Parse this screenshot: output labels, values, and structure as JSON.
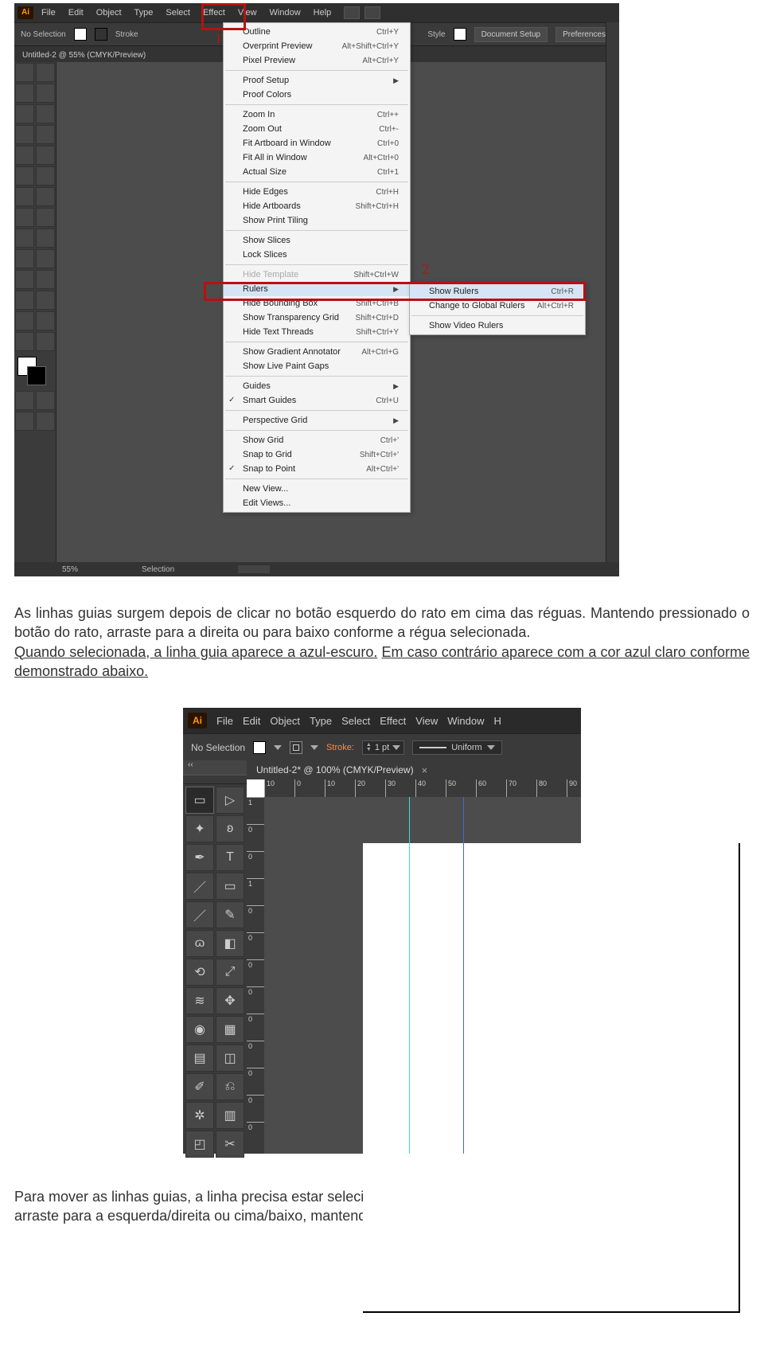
{
  "shot1": {
    "logo": "Ai",
    "menus": [
      "File",
      "Edit",
      "Object",
      "Type",
      "Select",
      "Effect",
      "View",
      "Window",
      "Help"
    ],
    "ctrl_no_selection": "No Selection",
    "ctrl_stroke": "Stroke",
    "ctrl_style": "Style",
    "ctrl_btn_docsetup": "Document Setup",
    "ctrl_btn_prefs": "Preferences",
    "doctab": "Untitled-2 @ 55% (CMYK/Preview)",
    "status_zoom": "55%",
    "status_sel": "Selection",
    "view_menu": [
      {
        "label": "Outline",
        "sc": "Ctrl+Y"
      },
      {
        "label": "Overprint Preview",
        "sc": "Alt+Shift+Ctrl+Y"
      },
      {
        "label": "Pixel Preview",
        "sc": "Alt+Ctrl+Y"
      },
      {
        "sep": true
      },
      {
        "label": "Proof Setup",
        "arrow": true
      },
      {
        "label": "Proof Colors"
      },
      {
        "sep": true
      },
      {
        "label": "Zoom In",
        "sc": "Ctrl++"
      },
      {
        "label": "Zoom Out",
        "sc": "Ctrl+-"
      },
      {
        "label": "Fit Artboard in Window",
        "sc": "Ctrl+0"
      },
      {
        "label": "Fit All in Window",
        "sc": "Alt+Ctrl+0"
      },
      {
        "label": "Actual Size",
        "sc": "Ctrl+1"
      },
      {
        "sep": true
      },
      {
        "label": "Hide Edges",
        "sc": "Ctrl+H"
      },
      {
        "label": "Hide Artboards",
        "sc": "Shift+Ctrl+H"
      },
      {
        "label": "Show Print Tiling"
      },
      {
        "sep": true
      },
      {
        "label": "Show Slices"
      },
      {
        "label": "Lock Slices"
      },
      {
        "sep": true
      },
      {
        "label": "Hide Template",
        "sc": "Shift+Ctrl+W",
        "disabled": true
      },
      {
        "label": "Rulers",
        "arrow": true,
        "sel": true
      },
      {
        "label": "Hide Bounding Box",
        "sc": "Shift+Ctrl+B"
      },
      {
        "label": "Show Transparency Grid",
        "sc": "Shift+Ctrl+D"
      },
      {
        "label": "Hide Text Threads",
        "sc": "Shift+Ctrl+Y"
      },
      {
        "sep": true
      },
      {
        "label": "Show Gradient Annotator",
        "sc": "Alt+Ctrl+G"
      },
      {
        "label": "Show Live Paint Gaps"
      },
      {
        "sep": true
      },
      {
        "label": "Guides",
        "arrow": true
      },
      {
        "label": "Smart Guides",
        "sc": "Ctrl+U",
        "check": true
      },
      {
        "sep": true
      },
      {
        "label": "Perspective Grid",
        "arrow": true
      },
      {
        "sep": true
      },
      {
        "label": "Show Grid",
        "sc": "Ctrl+'"
      },
      {
        "label": "Snap to Grid",
        "sc": "Shift+Ctrl+'"
      },
      {
        "label": "Snap to Point",
        "sc": "Alt+Ctrl+'",
        "check": true
      },
      {
        "sep": true
      },
      {
        "label": "New View..."
      },
      {
        "label": "Edit Views..."
      }
    ],
    "sub_menu": [
      {
        "label": "Show Rulers",
        "sc": "Ctrl+R",
        "sel": true
      },
      {
        "label": "Change to Global Rulers",
        "sc": "Alt+Ctrl+R"
      },
      {
        "sep": true
      },
      {
        "label": "Show Video Rulers"
      }
    ],
    "hi1": "1",
    "hi2": "2"
  },
  "para1": {
    "t1": "As linhas guias surgem depois de clicar no botão esquerdo do rato em cima das réguas. Mantendo pressionado o botão do rato, arraste para a direita ou para baixo conforme a régua selecionada.",
    "t2": "Quando selecionada, a linha guia aparece a azul-escuro.",
    "t3": " Em caso contrário aparece com a cor azul claro conforme demonstrado abaixo."
  },
  "shot2": {
    "logo": "Ai",
    "menus": [
      "File",
      "Edit",
      "Object",
      "Type",
      "Select",
      "Effect",
      "View",
      "Window",
      "H"
    ],
    "no_sel": "No Selection",
    "stroke": "Stroke:",
    "pt": "1 pt",
    "uniform": "Uniform",
    "doctab": "Untitled-2* @ 100% (CMYK/Preview)",
    "ticks_h": [
      "10",
      "0",
      "10",
      "20",
      "30",
      "40",
      "50",
      "60",
      "70",
      "80",
      "90"
    ],
    "ticks_v": [
      "1",
      "0",
      "0",
      "1",
      "0",
      "0",
      "0",
      "0",
      "0",
      "0",
      "0",
      "0",
      "0"
    ],
    "arrows": "‹‹"
  },
  "para2": "Para mover as linhas guias, a linha precisa estar selecionada e com o cursor de seleção em cima da mesma, arraste para a esquerda/direita ou cima/baixo, mantendo pressionado o botão esquerdo do rato."
}
